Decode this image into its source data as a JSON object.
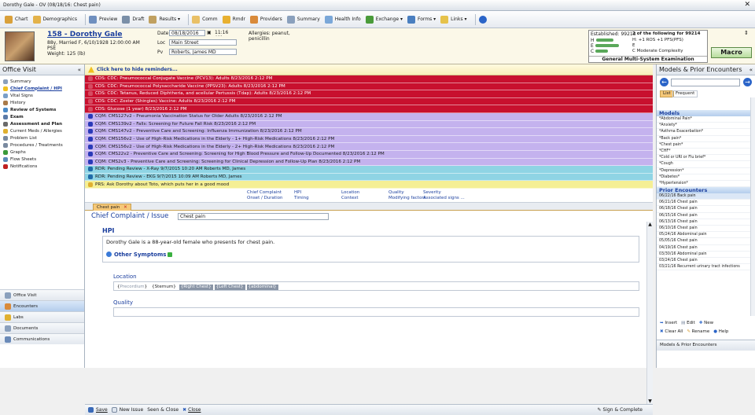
{
  "window_title": "Dorothy Gale - OV (08/18/16: Chest pain)",
  "toolbar": [
    {
      "label": "Chart",
      "icon": "chart-icon",
      "color": "#d9a03a"
    },
    {
      "label": "Demographics",
      "icon": "demographics-icon",
      "color": "#e3b24a"
    },
    {
      "label": "Preview",
      "icon": "preview-icon",
      "color": "#6f8fbf"
    },
    {
      "label": "Draft",
      "icon": "draft-icon",
      "color": "#7b8fa8"
    },
    {
      "label": "Results ▾",
      "icon": "results-icon",
      "color": "#c0a060"
    },
    {
      "label": "Comm",
      "icon": "comm-icon",
      "color": "#e9c066"
    },
    {
      "label": "Rmdr",
      "icon": "reminder-icon",
      "color": "#e8b030"
    },
    {
      "label": "Providers",
      "icon": "providers-icon",
      "color": "#d98a3a"
    },
    {
      "label": "Summary",
      "icon": "summary-icon",
      "color": "#8aa0bd"
    },
    {
      "label": "Health Info",
      "icon": "health-info-icon",
      "color": "#7aa7d8"
    },
    {
      "label": "Exchange ▾",
      "icon": "exchange-icon",
      "color": "#4a9b3a"
    },
    {
      "label": "Forms ▾",
      "icon": "forms-icon",
      "color": "#4a7fc0"
    },
    {
      "label": "Links ▾",
      "icon": "links-icon",
      "color": "#e6c24a"
    },
    {
      "label": "",
      "icon": "help-icon",
      "color": "#2a64c8"
    }
  ],
  "patient": {
    "name": "158 - Dorothy Gale",
    "line2": "88y, Married F, 6/10/1928 12:00:00 AM",
    "line3": "PSE",
    "line4": "Weight: 125 (lb)",
    "date_label": "Date",
    "date": "08/18/2016",
    "time": "11:16 AM",
    "loc_label": "Loc",
    "loc": "Main Street",
    "pv_label": "Pv",
    "pv": "Roberts, James MD",
    "allergies": "Allergies: peanut, penicillin"
  },
  "established": {
    "title": "Established: 99213",
    "h": "H",
    "e": "E",
    "c": "C",
    "right_title": "2 of the following for 99214",
    "r1": "H: +1 ROS +1 PFS(PFS)",
    "r2": "E",
    "r3": "C Moderate Complexity",
    "footer": "General Multi-System Examination",
    "macro": "Macro"
  },
  "left_panel": {
    "title": "Office Visit",
    "items": [
      {
        "label": "Summary",
        "bold": false,
        "icon": "summary-icon",
        "color": "#8aa0bd"
      },
      {
        "label": "Chief Complaint / HPI",
        "bold": true,
        "active": true,
        "icon": "warning-icon",
        "color": "#f0c020"
      },
      {
        "label": "Vital Signs",
        "bold": false,
        "icon": "vital-signs-icon",
        "color": "#7a9fc8"
      },
      {
        "label": "History",
        "bold": false,
        "icon": "history-icon",
        "color": "#a87a4a"
      },
      {
        "label": "Review of Systems",
        "bold": true,
        "icon": "review-icon",
        "color": "#4a8ac8"
      },
      {
        "label": "Exam",
        "bold": true,
        "icon": "exam-icon",
        "color": "#5a7aa8"
      },
      {
        "label": "Assessment and Plan",
        "bold": true,
        "icon": "assessment-icon",
        "color": "#6a6a6a"
      },
      {
        "label": "Current Meds / Allergies",
        "bold": false,
        "icon": "meds-icon",
        "color": "#e0b030"
      },
      {
        "label": "Problem List",
        "bold": false,
        "icon": "problem-list-icon",
        "color": "#7a8aa0"
      },
      {
        "label": "Procedures / Treatments",
        "bold": false,
        "icon": "procedures-icon",
        "color": "#7a8aa0"
      },
      {
        "label": "Graphs",
        "bold": false,
        "icon": "graphs-icon",
        "color": "#3a9a3a"
      },
      {
        "label": "Flow Sheets",
        "bold": false,
        "icon": "flow-sheets-icon",
        "color": "#5a8ab8"
      },
      {
        "label": "Notifications",
        "bold": false,
        "icon": "notifications-icon",
        "color": "#c02020"
      }
    ],
    "bottom": [
      {
        "label": "Office Visit",
        "icon": "office-visit-icon",
        "color": "#8aa0bd"
      },
      {
        "label": "Encounters",
        "icon": "encounters-icon",
        "color": "#d98a3a"
      },
      {
        "label": "Labs",
        "icon": "labs-icon",
        "color": "#e0b030"
      },
      {
        "label": "Documents",
        "icon": "documents-icon",
        "color": "#8aa0bd"
      },
      {
        "label": "Communications",
        "icon": "communications-icon",
        "color": "#6a8ab8"
      }
    ]
  },
  "reminders": {
    "header": "Click here to hide reminders...",
    "items": [
      {
        "type": "cds",
        "text": "CDS: CDC: Pneumococcal Conjugate Vaccine (PCV13): Adults    8/23/2016 2:12 PM"
      },
      {
        "type": "cds",
        "text": "CDS: CDC: Pneumococcal Polysaccharide Vaccine (PPSV23): Adults    8/23/2016 2:12 PM"
      },
      {
        "type": "cds",
        "text": "CDS: CDC: Tetanus, Reduced Diphtheria, and acellular Pertussis (Tdap): Adults    8/23/2016 2:12 PM"
      },
      {
        "type": "cds",
        "text": "CDS: CDC: Zoster (Shingles) Vaccine: Adults    8/23/2016 2:12 PM"
      },
      {
        "type": "cds",
        "text": "CDS: Glucose (1 year)    8/23/2016 2:12 PM"
      },
      {
        "type": "cqm",
        "text": "CQM: CMS127v2 - Pneumonia Vaccination Status for Older Adults    8/23/2016 2:12 PM"
      },
      {
        "type": "cqm",
        "text": "CQM: CMS139v2 - Falls: Screening for Future Fall Risk    8/23/2016 2:12 PM"
      },
      {
        "type": "cqm",
        "text": "CQM: CMS147v2 - Preventive Care and Screening: Influenza Immunization    8/23/2016 2:12 PM"
      },
      {
        "type": "cqm",
        "text": "CQM: CMS156v2 - Use of High-Risk Medications in the Elderly - 1+ High-Risk Medications    8/23/2016 2:12 PM"
      },
      {
        "type": "cqm",
        "text": "CQM: CMS156v2 - Use of High-Risk Medications in the Elderly - 2+ High-Risk Medications    8/23/2016 2:12 PM"
      },
      {
        "type": "cqm",
        "text": "CQM: CMS22v2 - Preventive Care and Screening: Screening for High Blood Pressure and Follow-Up Documented    8/23/2016 2:12 PM"
      },
      {
        "type": "cqm",
        "text": "CQM: CMS2v3 - Preventive Care and Screening: Screening for Clinical Depression and Follow-Up Plan    8/23/2016 2:12 PM"
      },
      {
        "type": "rdr",
        "text": "RDR: Pending Review - X-Ray    9/7/2015 10:20 AM    Roberts MD, James"
      },
      {
        "type": "rdr",
        "text": "RDR: Pending Review - EKG    9/7/2015 10:09 AM    Roberts MD, James"
      },
      {
        "type": "prs",
        "text": "PRS: Ask Dorothy about Toto, which puts her in a good mood"
      }
    ]
  },
  "quick_links": {
    "cc": "Chief Complaint",
    "onset": "Onset / Duration",
    "hpi": "HPI",
    "timing": "Timing",
    "location": "Location",
    "context": "Context",
    "quality": "Quality",
    "modifying": "Modifying factors",
    "severity": "Severity",
    "assoc": "Associated signs ..."
  },
  "tab": "Chest pain",
  "editor": {
    "cc_label": "Chief Complaint / Issue",
    "cc_value": "Chest pain",
    "hpi_label": "HPI",
    "hpi_text": "Dorothy Gale is a 88-year-old female who presents for chest pain.",
    "other_symptoms": "Other Symptoms",
    "location_label": "Location",
    "location_chips": [
      "Precordium",
      "Sternum",
      "Right Chest",
      "Left Chest",
      "abdominal"
    ],
    "quality_label": "Quality"
  },
  "footer": {
    "save": "Save",
    "new_issue": "New Issue",
    "seen_close": "Seen & Close",
    "close": "Close",
    "sign_complete": "Sign & Complete"
  },
  "right_panel": {
    "title": "Models & Prior Encounters",
    "tab_list": "List",
    "tab_frequent": "Frequent",
    "models_label": "Models",
    "models": [
      "*Abdominal Pain*",
      "*Anxiety*",
      "*Asthma Exacerbation*",
      "*Back pain*",
      "*Chest pain*",
      "*CHF*",
      "*Cold or URI or Flu brief*",
      "*Cough",
      "*Depression*",
      "*Diabetes*",
      "*Hypertension*"
    ],
    "prior_label": "Prior Encounters",
    "prior": [
      "06/22/16 Back pain",
      "06/21/16 Chest pain",
      "06/18/16 Chest pain",
      "06/15/16 Chest pain",
      "06/13/16 Chest pain",
      "06/10/16 Chest pain",
      "05/24/16 Abdominal pain",
      "05/05/16 Chest pain",
      "04/19/16 Chest pain",
      "03/30/16 Abdominal pain",
      "03/24/16 Chest pain",
      "03/21/16 Recurrent urinary tract infections"
    ],
    "insert": "Insert",
    "edit": "Edit",
    "new": "New",
    "clear_all": "Clear All",
    "rename": "Rename",
    "help": "Help",
    "footer": "Models & Prior Encounters"
  }
}
